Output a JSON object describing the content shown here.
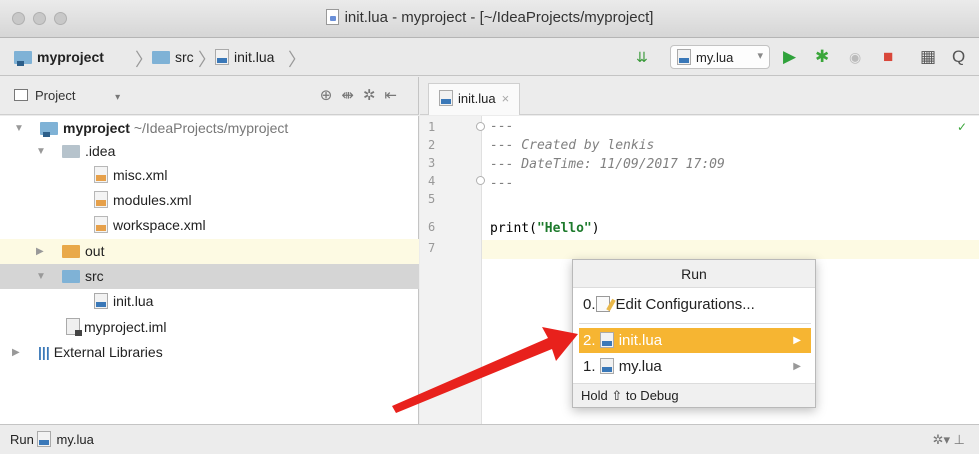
{
  "window": {
    "title": "init.lua - myproject - [~/IdeaProjects/myproject]"
  },
  "breadcrumb": {
    "project": "myproject",
    "folder": "src",
    "file": "init.lua"
  },
  "toolbar": {
    "run_config": "my.lua"
  },
  "project_panel": {
    "title": "Project",
    "tree": {
      "root_name": "myproject",
      "root_path": "~/IdeaProjects/myproject",
      "idea_folder": ".idea",
      "misc": "misc.xml",
      "modules": "modules.xml",
      "workspace": "workspace.xml",
      "out": "out",
      "src": "src",
      "init_lua": "init.lua",
      "iml": "myproject.iml",
      "external": "External Libraries"
    }
  },
  "editor": {
    "tab": "init.lua",
    "line_numbers": [
      "1",
      "2",
      "3",
      "4",
      "5",
      "6",
      "7"
    ],
    "lines": {
      "l1": "---",
      "l2": "--- Created by lenkis",
      "l3": "--- DateTime: 11/09/2017 17:09",
      "l4": "---",
      "l6_fn": "print(",
      "l6_str": "\"Hello\"",
      "l6_end": ")"
    }
  },
  "run_popup": {
    "title": "Run",
    "edit_prefix": "0.",
    "edit_label": "Edit Configurations...",
    "item1_prefix": "2.",
    "item1_label": "init.lua",
    "item2_prefix": "1.",
    "item2_label": "my.lua",
    "footer": "Hold ⇧ to Debug"
  },
  "status_bar": {
    "run_label": "Run",
    "run_config": "my.lua"
  },
  "colors": {
    "selection": "#f6b532",
    "annotation_arrow": "#e8211c",
    "folder": "#7fb2d6"
  }
}
